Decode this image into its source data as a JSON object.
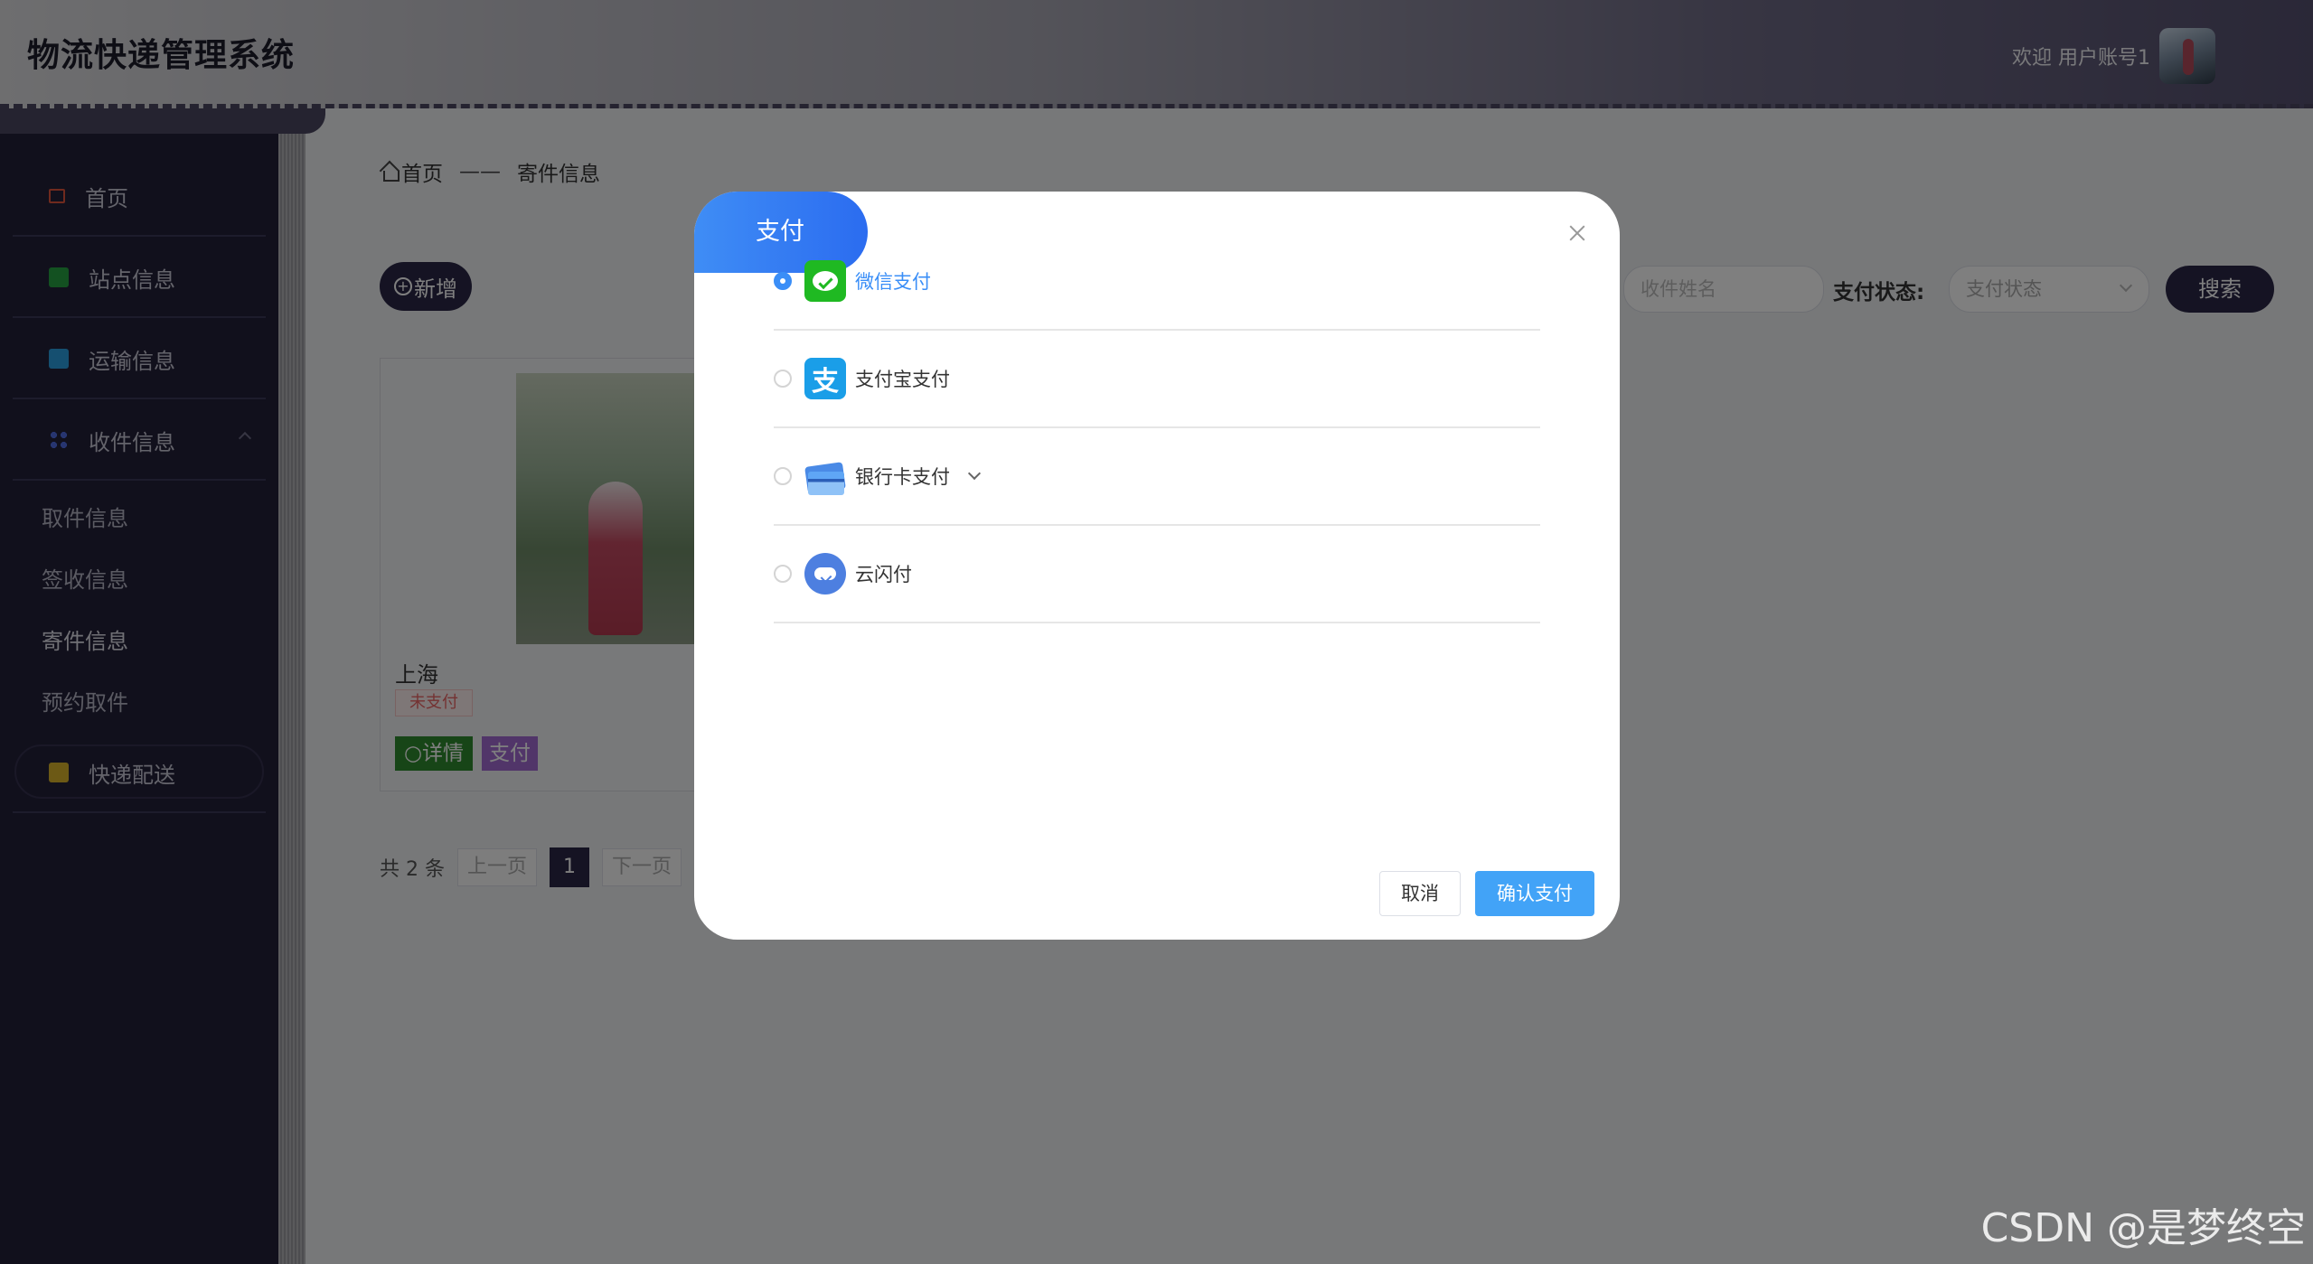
{
  "app": {
    "title": "物流快递管理系统",
    "welcome": "欢迎 用户账号1"
  },
  "sidebar": {
    "items": [
      {
        "label": "首页",
        "icon": "home-icon",
        "color": "#e0553d"
      },
      {
        "label": "站点信息",
        "icon": "book-icon",
        "color": "#27a243"
      },
      {
        "label": "运输信息",
        "icon": "bookmark-icon",
        "color": "#2a9ee0"
      },
      {
        "label": "收件信息",
        "icon": "grid-icon",
        "color": "#4f6be0"
      },
      {
        "label": "快递配送",
        "icon": "folder-icon",
        "color": "#d9b32a"
      }
    ],
    "sub_items": [
      "取件信息",
      "签收信息",
      "寄件信息",
      "预约取件"
    ],
    "active_sub": "寄件信息"
  },
  "breadcrumb": {
    "home": "首页",
    "separator": "——",
    "current": "寄件信息"
  },
  "toolbar": {
    "add_label": "新增",
    "search_placeholder": "收件姓名",
    "pay_status_label": "支付状态:",
    "pay_status_placeholder": "支付状态",
    "search_label": "搜索"
  },
  "card": {
    "title": "上海",
    "status": "未支付",
    "detail_label": "详情",
    "pay_label": "支付"
  },
  "pager": {
    "total": "共 2 条",
    "prev": "上一页",
    "current": "1",
    "next": "下一页"
  },
  "modal": {
    "title": "支付",
    "options": [
      {
        "label": "微信支付",
        "icon": "wechat-icon",
        "selected": true
      },
      {
        "label": "支付宝支付",
        "icon": "alipay-icon",
        "icon_glyph": "支",
        "selected": false
      },
      {
        "label": "银行卡支付",
        "icon": "bank-card-icon",
        "selected": false,
        "has_dropdown": true
      },
      {
        "label": "云闪付",
        "icon": "cloud-pay-icon",
        "selected": false
      }
    ],
    "cancel_label": "取消",
    "confirm_label": "确认支付"
  },
  "watermark": "CSDN @是梦终空"
}
